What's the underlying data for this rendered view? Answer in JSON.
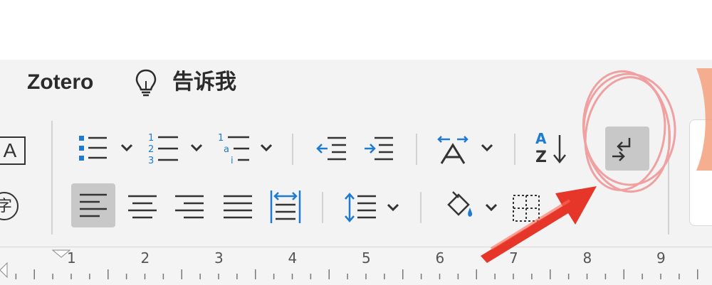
{
  "menu": {
    "zotero_label": "Zotero",
    "tell_me_label": "告诉我"
  },
  "ruler": {
    "numbers": [
      "1",
      "2",
      "3",
      "4",
      "5",
      "6",
      "7",
      "8",
      "9"
    ]
  },
  "icons": {
    "text_box_glyph": "A",
    "sort_glyph_top": "A",
    "sort_glyph_bottom": "Z",
    "phonetic_glyph": "字"
  },
  "colors": {
    "accent_blue": "#1f7bd0",
    "icon_gray": "#333333",
    "selected_bg": "#c8c8c8",
    "annotation_red": "#e52b1f"
  }
}
